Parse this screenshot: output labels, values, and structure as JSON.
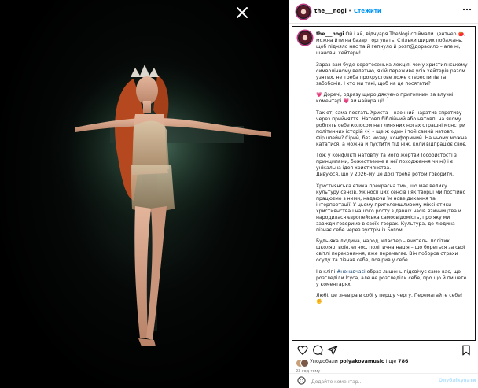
{
  "close_icon": "close-icon",
  "header": {
    "username": "the___nogi",
    "separator": "•",
    "follow_label": "Стежити",
    "more_icon": "more-horizontal-icon"
  },
  "caption": {
    "username": "the___nogi",
    "paragraphs": [
      "Ой і ай, відчуаря TheNogi спіймали центнер 🍅, можна йти на базар торгувать. Стільки щирих побажань, щоб підняло нас та й гепнуло й розп@дорасило – але ні, шановні хейтери!",
      "Зараз вам буде коротесенька лекція, чому християнському символічному велетню, якій переживе усіх хейтерів разом узятих, не треба прокрустове ложе стереотипів та забобонів. І хто ми такі, щоб на це посягати?",
      "💗 Доречі, одразу щиро дякуємо притомним за влучні коментарі 💗 ви найкращі!",
      "Так от, сама постать Христа – наочний наратив спротиву через прийняття. Натовп біблійний або натовп, на якому роблять себе колосом на глиняних ногах страшні монстри політичних історій 👀 – ще ж один і той самий натовп. Фіршлейн? Сірий, без мозку, конформний. На ньому можна кататися, а можна й пустити під ніж, коли відпрацює своє.",
      "Тож у конфлікті натовпу та його жертви (особистості з принципами, божественне в неї походження чи ні) і є унікальна ідея християнства.\nДивуюся, що у 2026-му це досі треба ротом говорити.",
      "Християнська етика прекрасна тим, що має велику культуру сенсів. Як носії цих сенсів і як творці ми постійно працюємо з ними, надаючи їм нове дихання та інтерпретації. У цьому приголомшливому міксі етики християнства і нашого росту з давніх часів язичництва й народилася європейська самосвідомість, про яку ми завжди говоримо в своїх творах. Культура, де людина пізнає себе через зустріч із Богом.",
      "Будь-яка людина, народ, кластер – вчитель, політик, школяр, воїн, етнос, політична нація – що бореться за свої світлі переконання, вже перемагає. Він поборов страхи осуду та пізнав себе, повірив у себе.",
      "І в кліпі #ненавчасі образ лишень підсвічує саме вас, що розгледіли Ісуса, але не розгледіли себе, про що й пишете у коментарях.",
      "Любі, це зневіра в собі у першу чергу. Перемагайте себе! ✊"
    ],
    "hashtag": "#ненавчасі"
  },
  "actions": {
    "like_icon": "heart-icon",
    "comment_icon": "comment-icon",
    "share_icon": "share-icon",
    "save_icon": "bookmark-icon"
  },
  "likes": {
    "prefix": "Уподобали",
    "user": "polyakovamusic",
    "mid": "і ще",
    "count": "786"
  },
  "time_ago": "23 год тому",
  "comment": {
    "emoji_icon": "emoji-icon",
    "placeholder": "Додайте коментар…",
    "publish_label": "Опублікувати"
  },
  "colors": {
    "accent": "#0095f6",
    "publish_disabled": "#b2dffc",
    "photo_bg": "#000000"
  }
}
